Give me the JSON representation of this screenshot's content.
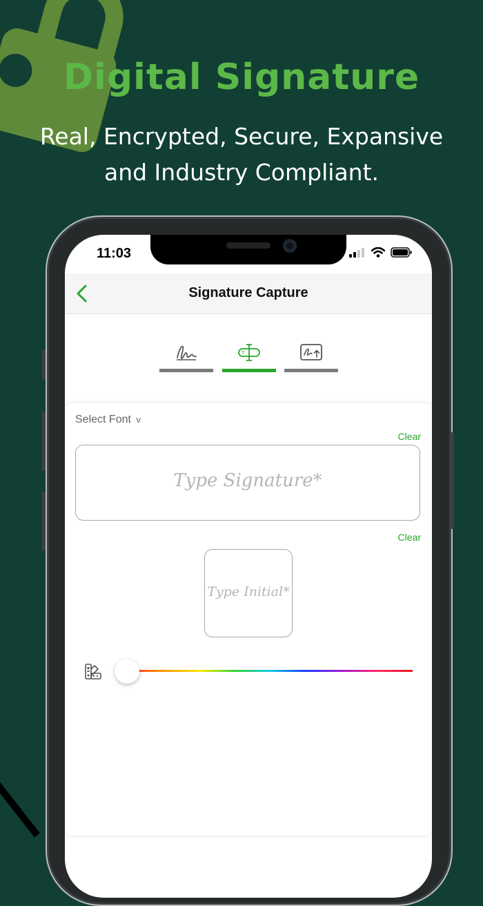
{
  "hero": {
    "title": "Digital Signature",
    "subtitle_line1": "Real, Encrypted, Secure, Expansive",
    "subtitle_line2": "and Industry Compliant."
  },
  "status_bar": {
    "time": "11:03",
    "icons": [
      "cellular-signal-icon",
      "wifi-icon",
      "battery-icon"
    ]
  },
  "navbar": {
    "back_icon": "chevron-left-icon",
    "title": "Signature Capture"
  },
  "tabs": [
    {
      "icon": "draw-signature-icon",
      "active": false
    },
    {
      "icon": "type-signature-icon",
      "active": true
    },
    {
      "icon": "upload-signature-icon",
      "active": false
    }
  ],
  "form": {
    "select_font_label": "Select Font",
    "select_font_chevron": "v",
    "clear_signature": "Clear",
    "signature_placeholder": "Type Signature*",
    "clear_initial": "Clear",
    "initial_placeholder": "Type Initial*"
  },
  "color_slider": {
    "icon": "color-palette-icon",
    "value": 0
  },
  "colors": {
    "background": "#113f33",
    "accent": "#2aa52a",
    "title_green": "#5cb848",
    "lock_green": "#5f8a3a"
  }
}
